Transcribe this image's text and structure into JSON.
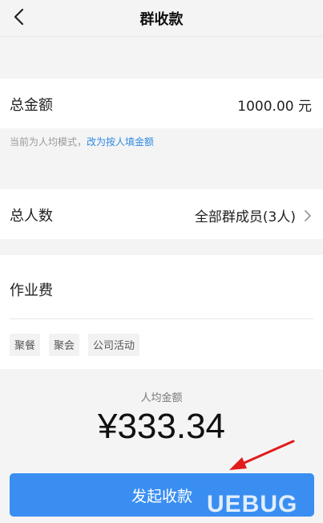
{
  "header": {
    "title": "群收款"
  },
  "total_amount": {
    "label": "总金额",
    "value": "1000.00 元"
  },
  "mode_hint": {
    "text": "当前为人均模式，",
    "link": "改为按人填金额"
  },
  "total_people": {
    "label": "总人数",
    "value": "全部群成员(3人)"
  },
  "purpose": {
    "value": "作业费",
    "tags": [
      "聚餐",
      "聚会",
      "公司活动"
    ]
  },
  "average": {
    "label": "人均金额",
    "amount": "¥333.34"
  },
  "submit": {
    "label": "发起收款"
  },
  "watermark": {
    "text": "UEBUG"
  },
  "colors": {
    "accent": "#3a8ef2",
    "link": "#2f8ae3",
    "annotation_arrow": "#e11b1b"
  }
}
